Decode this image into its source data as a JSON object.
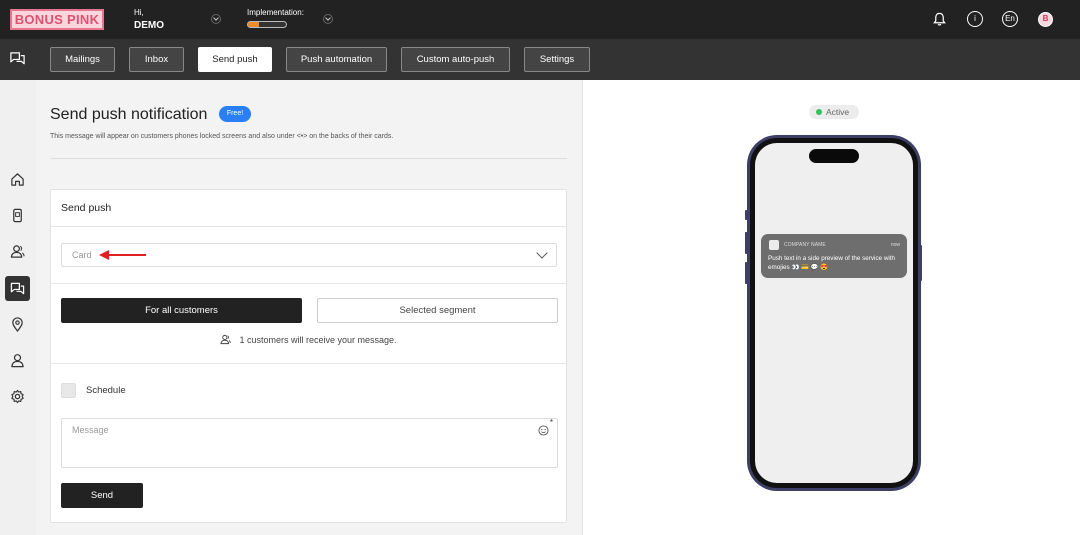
{
  "brand": {
    "logo_text": "BONUS PINK",
    "accent": "#e8748f"
  },
  "header": {
    "greeting": "Hi,",
    "user_name": "DEMO",
    "implementation_label": "Implementation:",
    "implementation_progress": 0.28,
    "language": "En",
    "avatar_letter": "B",
    "icons": [
      "bell-icon",
      "info-icon",
      "language-icon",
      "profile-icon"
    ]
  },
  "tabs": [
    {
      "label": "Mailings",
      "active": false
    },
    {
      "label": "Inbox",
      "active": false
    },
    {
      "label": "Send push",
      "active": true
    },
    {
      "label": "Push automation",
      "active": false
    },
    {
      "label": "Custom auto-push",
      "active": false
    },
    {
      "label": "Settings",
      "active": false
    }
  ],
  "sidebar": {
    "items": [
      "home-icon",
      "device-icon",
      "customers-icon",
      "chat-icon",
      "location-icon",
      "user-icon",
      "settings-icon"
    ],
    "active": "chat-icon"
  },
  "main": {
    "title": "Send push notification",
    "badge": "Free!",
    "subtitle": "This message will appear on customers phones locked screens and also under <•> on the backs of their cards.",
    "card": {
      "title": "Send push",
      "card_placeholder": "Card",
      "for_all_label": "For all customers",
      "segment_label": "Selected segment",
      "receive_text": "1 customers will receive your message.",
      "schedule_label": "Schedule",
      "message_placeholder": "Message",
      "required_mark": "*",
      "send_label": "Send"
    }
  },
  "preview": {
    "status": "Active",
    "status_color": "#33c05a",
    "notification": {
      "app_name": "COMPANY NAME",
      "time": "now",
      "body": "Push text in a side preview of the service with emojies 👀 💳 💬 😍"
    }
  }
}
